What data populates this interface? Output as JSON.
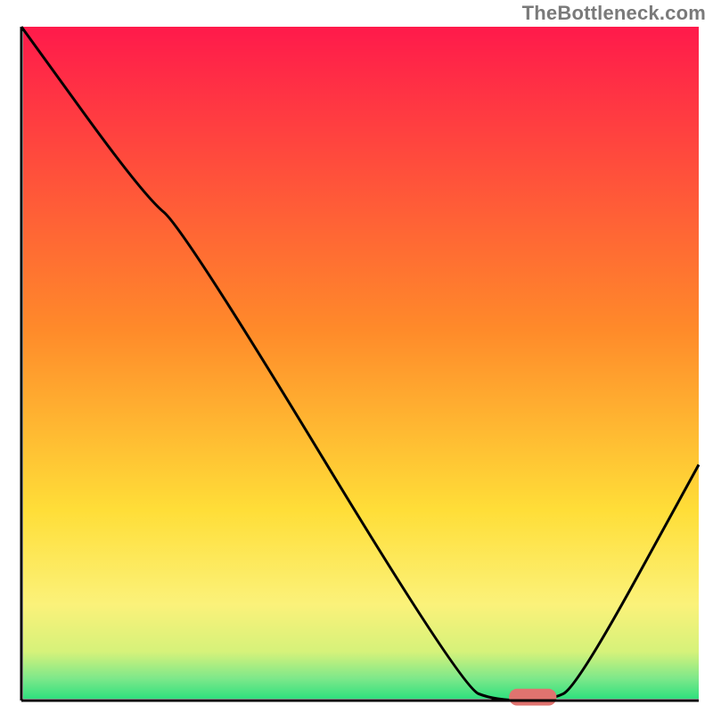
{
  "watermark": "TheBottleneck.com",
  "chart_data": {
    "type": "line",
    "title": "",
    "xlabel": "",
    "ylabel": "",
    "xlim": [
      0,
      100
    ],
    "ylim": [
      0,
      100
    ],
    "background_gradient_stops": [
      {
        "offset": 0,
        "color": "#ff1a4b"
      },
      {
        "offset": 0.45,
        "color": "#ff8a2a"
      },
      {
        "offset": 0.72,
        "color": "#ffde38"
      },
      {
        "offset": 0.86,
        "color": "#fbf27a"
      },
      {
        "offset": 0.93,
        "color": "#d6f27a"
      },
      {
        "offset": 0.97,
        "color": "#7de88a"
      },
      {
        "offset": 1.0,
        "color": "#2fe07e"
      }
    ],
    "curve_points": [
      {
        "x": 0,
        "y": 100
      },
      {
        "x": 18,
        "y": 75
      },
      {
        "x": 24,
        "y": 70
      },
      {
        "x": 65,
        "y": 2
      },
      {
        "x": 70,
        "y": 0
      },
      {
        "x": 78,
        "y": 0
      },
      {
        "x": 82,
        "y": 2
      },
      {
        "x": 100,
        "y": 35
      }
    ],
    "marker": {
      "x_start": 72,
      "x_end": 79,
      "y": 0.5,
      "color": "#e0736f",
      "thickness": 2.5
    },
    "axes": {
      "left": {
        "x": 3,
        "y0": 0,
        "y1": 100
      },
      "bottom": {
        "y": 0,
        "x0": 3,
        "x1": 100
      }
    },
    "line_color": "#000000",
    "line_width": 3
  }
}
